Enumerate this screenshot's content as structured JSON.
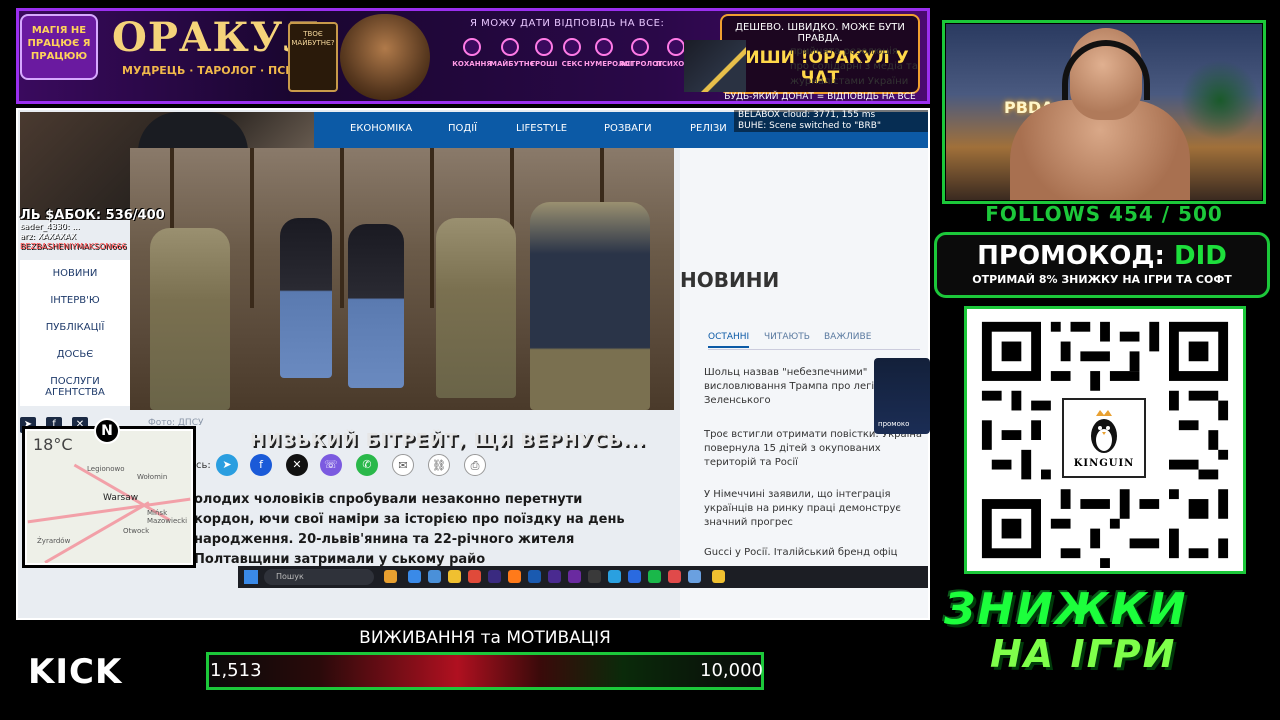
{
  "banner": {
    "badge_text": "МАГІЯ НЕ ПРАЦЮЄ Я ПРАЦЮЮ",
    "title": "ОРАКУЛ",
    "subtitle": "МУДРЕЦЬ · ТАРОЛОГ · ПСИХОЛОГ",
    "card_text": "ТВОЄ МАЙБУТНЄ?",
    "headline": "Я МОЖУ ДАТИ ВІДПОВІДЬ НА ВСЕ:",
    "categories": [
      "КОХАННЯ",
      "МАЙБУТНЄ",
      "ГРОШІ",
      "СЕКС",
      "НУМЕРОЛОГ",
      "АСТРОЛОГ",
      "ПСИХОЛОГ"
    ],
    "cta_line1": "ДЕШЕВО. ШВИДКО. МОЖЕ БУТИ ПРАВДА.",
    "cta_line2": "ПИШИ !ОРАКУЛ У ЧАТ",
    "cta_line3": "БУДЬ-ЯКИЙ ДОНАТ = ВІДПОВІДЬ НА ВСЕ"
  },
  "capture": {
    "subs_counter": "ЛЬ $АБОК: 536/400",
    "chat_lines": [
      "sader_4330: ...",
      "arz: ХАХАХАХ",
      "BEZBASHENIYMAKSON666"
    ],
    "sidebar_menu": [
      "НОВИНИ",
      "ІНТЕРВ'Ю",
      "ПУБЛІКАЦІЇ",
      "ДОСЬЄ",
      "ПОСЛУГИ АГЕНТСТВА"
    ],
    "nav": [
      "ЕКОНОМІКА",
      "ПОДІЇ",
      "LIFESTYLE",
      "РОЗВАГИ",
      "РЕЛІЗИ"
    ],
    "notify_l1": "BELABOX cloud: 3771, 155 ms",
    "notify_l2": "BUHE: Scene switched to \"BRB\"",
    "photo_caption": "Фото: ДПСУ",
    "share_label": "сь:",
    "article_text": "олодих чоловіків спробували незаконно перетнути кордон, ючи свої наміри за історією про поїздку на день народження. 20-львів'янина та 22-річного жителя Полтавщини затримали у ському райо",
    "right_snippet": "прийнята резолюція про солідарні з медіа та журналістами України",
    "news_title": "НОВИНИ",
    "tabs": [
      "ОСТАННІ",
      "ЧИТАЮТЬ",
      "ВАЖЛИВЕ"
    ],
    "news_items": [
      "Шольц назвав \"небезпечними\" висловлювання Трампа про легітимність Зеленського",
      "Троє встигли отримати повістки: Україна повернула 15 дітей з окупованих територій та Росії",
      "У Німеччині заявили, що інтеграція українців на ринку праці демонструє значний прогрес",
      "Gucci у Росії. Італійський бренд офіц"
    ],
    "tg_label": "промоко",
    "subtitle": "НИЗЬКИЙ БІТРЕЙТ, ЩЯ ВЕРНУСЬ...",
    "map_temp": "18°C",
    "map_cities": [
      "Legionowo",
      "Wołomin",
      "Warsaw",
      "Mińsk Mazowiecki",
      "Otwock",
      "Żyrardów"
    ],
    "map_logo": "N",
    "taskbar_search": "Пошук"
  },
  "webcam": {
    "neon": "PBDA"
  },
  "follows": "FOLLOWS 454 / 500",
  "promo": {
    "label": "ПРОМОКОД: ",
    "code": "DID",
    "sub": "ОТРИМАЙ 8% ЗНИЖКУ НА ІГРИ ТА СОФТ"
  },
  "kinguin_label": "KINGUIN",
  "discount_l1": "ЗНИЖКИ",
  "discount_l2": "НА ІГРИ",
  "kick_logo": "KICK",
  "goal": {
    "title": "ВИЖИВАННЯ та МОТИВАЦІЯ",
    "current": "1,513",
    "target": "10,000"
  },
  "colors": {
    "accent_green": "#1cc83a",
    "banner_purple": "#9b2ff0",
    "site_blue": "#0c5aa6"
  }
}
